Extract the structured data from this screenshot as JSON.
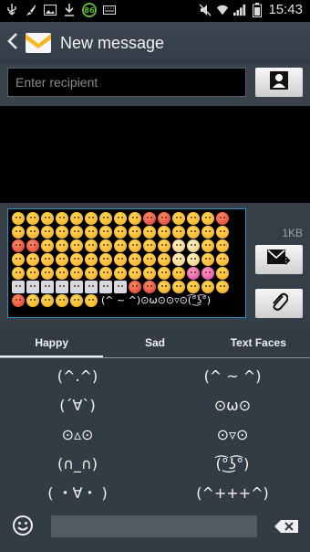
{
  "statusbar": {
    "badge": "86",
    "time": "15:43"
  },
  "header": {
    "title": "New message"
  },
  "recipient": {
    "placeholder": "Enter recipient"
  },
  "compose": {
    "inline_text": "(^ ~ ^)⊙ω⊙⊙▿⊙(͡°͜ʖ͡°)",
    "size_label": "1KB"
  },
  "tabs": [
    {
      "label": "Happy",
      "active": true
    },
    {
      "label": "Sad"
    },
    {
      "label": "Text Faces"
    }
  ],
  "faces": [
    [
      "(^.^)",
      "(^ ~ ^)"
    ],
    [
      "(´∀`)",
      "⊙ω⊙"
    ],
    [
      "⊙▵⊙",
      "⊙▿⊙"
    ],
    [
      "(∩_∩)",
      "(͡°͜ʖ͡°)"
    ],
    [
      "( ・∀・ )",
      "(^+++^)"
    ]
  ],
  "colors": {
    "accent": "#2e8fc4",
    "header": "#3d4754",
    "panel": "#333b45",
    "badge": "#5fb52d"
  },
  "icons": [
    "usb-icon",
    "brush-icon",
    "image-icon",
    "download-icon",
    "keyboard-icon",
    "mute-icon",
    "wifi-icon",
    "signal-icon",
    "battery-icon",
    "back-icon",
    "envelope-icon",
    "contact-icon",
    "send-icon",
    "attach-icon",
    "smiley-icon",
    "delete-icon"
  ]
}
